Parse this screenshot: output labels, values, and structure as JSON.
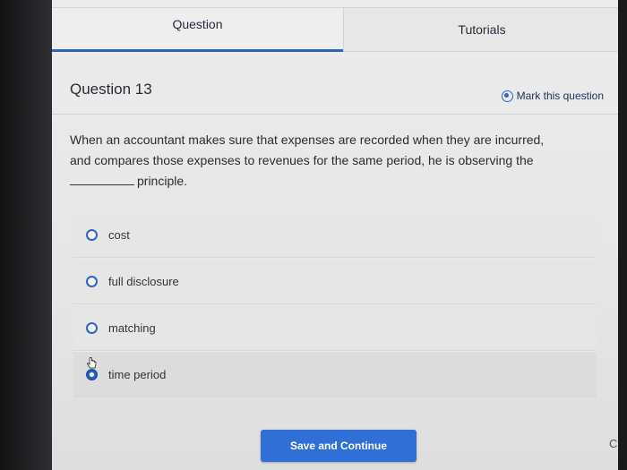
{
  "tabs": [
    {
      "label": "Question",
      "active": true
    },
    {
      "label": "Tutorials",
      "active": false
    }
  ],
  "question": {
    "title": "Question 13",
    "mark_label": "Mark this question",
    "prompt_line1": "When an accountant makes sure that expenses are recorded when they are incurred,",
    "prompt_line2": "and compares those expenses to revenues for the same period, he is observing the",
    "prompt_line3": "principle."
  },
  "options": [
    {
      "label": "cost",
      "selected": false
    },
    {
      "label": "full disclosure",
      "selected": false
    },
    {
      "label": "matching",
      "selected": false
    },
    {
      "label": "time period",
      "selected": true
    }
  ],
  "actions": {
    "save_label": "Save and Continue",
    "continue_partial": "C"
  },
  "colors": {
    "accent": "#2f63c4",
    "button": "#2f6fd6"
  }
}
